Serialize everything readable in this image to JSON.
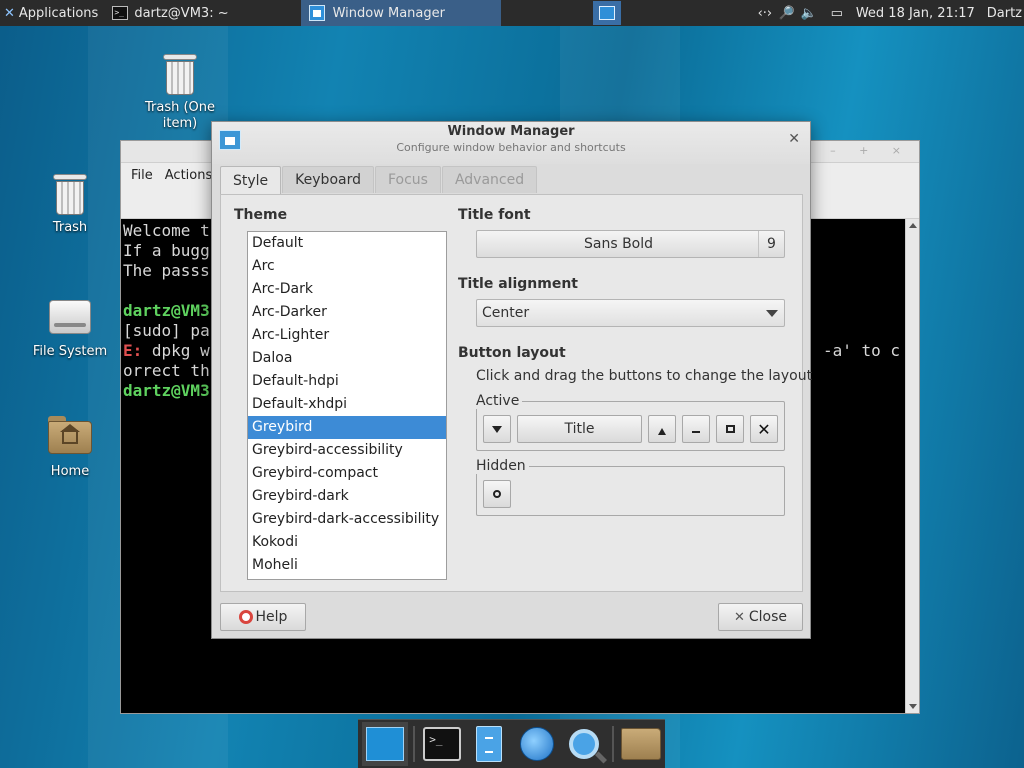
{
  "top_panel": {
    "applications_label": "Applications",
    "tasks": [
      {
        "label": "dartz@VM3: ~"
      },
      {
        "label": "Window Manager"
      }
    ],
    "clock": "Wed 18 Jan, 21:17",
    "user": "Dartz"
  },
  "desktop": {
    "icons": [
      {
        "label": "Trash (One item)"
      },
      {
        "label": "Trash"
      },
      {
        "label": "File System"
      },
      {
        "label": "Home"
      }
    ]
  },
  "terminal": {
    "menu": [
      "File",
      "Actions"
    ],
    "lines": {
      "l1": "Welcome t",
      "l2": "If a bugg",
      "l3": "The passs",
      "l4_prompt": "dartz@VM3",
      "l5": "[sudo] pa",
      "l6_err": "E:",
      "l6_rest": " dpkg w",
      "l6_right": "-a' to c",
      "l7": "orrect th",
      "l8_prompt": "dartz@VM3"
    }
  },
  "dialog": {
    "title": "Window Manager",
    "subtitle": "Configure window behavior and shortcuts",
    "tabs": [
      {
        "label": "Style"
      },
      {
        "label": "Keyboard"
      },
      {
        "label": "Focus"
      },
      {
        "label": "Advanced"
      }
    ],
    "theme_heading": "Theme",
    "themes": [
      "Default",
      "Arc",
      "Arc-Dark",
      "Arc-Darker",
      "Arc-Lighter",
      "Daloa",
      "Default-hdpi",
      "Default-xhdpi",
      "Greybird",
      "Greybird-accessibility",
      "Greybird-compact",
      "Greybird-dark",
      "Greybird-dark-accessibility",
      "Kokodi",
      "Moheli"
    ],
    "selected_theme": "Greybird",
    "title_font_heading": "Title font",
    "title_font_name": "Sans Bold",
    "title_font_size": "9",
    "title_alignment_heading": "Title alignment",
    "title_alignment_value": "Center",
    "button_layout_heading": "Button layout",
    "button_layout_hint": "Click and drag the buttons to change the layout",
    "active_label": "Active",
    "hidden_label": "Hidden",
    "layout_title_button": "Title",
    "help_label": "Help",
    "close_label": "Close"
  },
  "colors": {
    "selection": "#3d8bd6",
    "terminal_prompt": "#5fd35f",
    "terminal_error": "#e05050",
    "panel": "#2b2b2b"
  }
}
